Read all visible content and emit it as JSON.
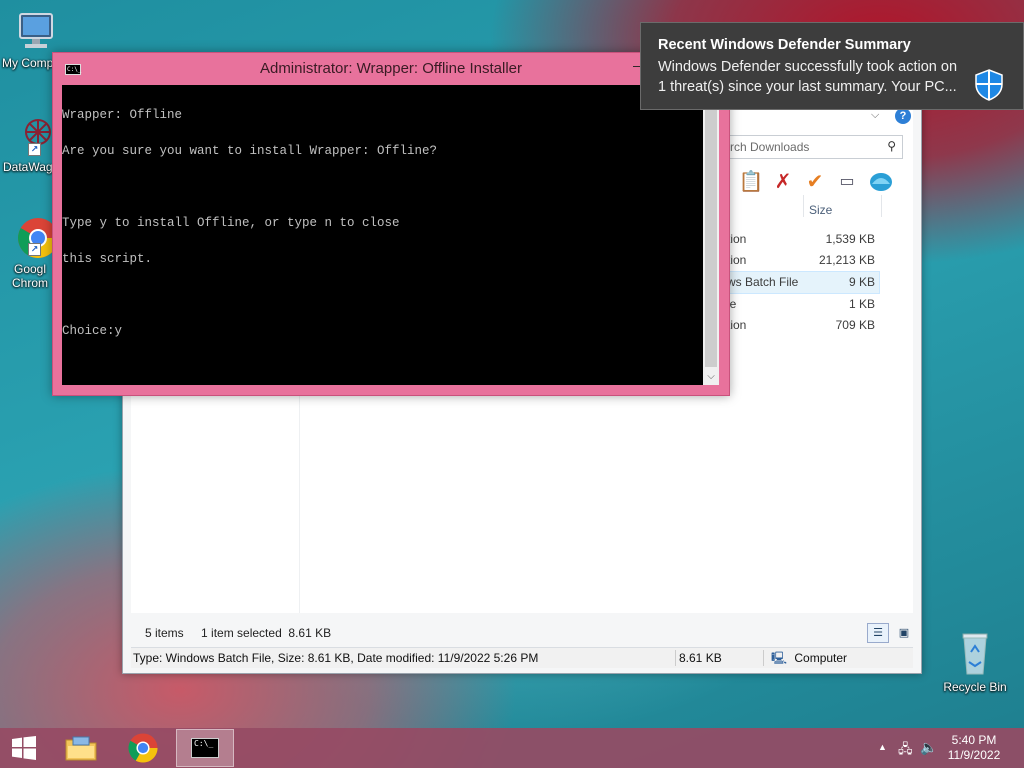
{
  "desktop": {
    "icons": [
      {
        "label": "My Comp"
      },
      {
        "label": "DataWag"
      },
      {
        "label": "Googl Chrom"
      },
      {
        "label": "Recycle Bin"
      }
    ]
  },
  "explorer": {
    "search_placeholder": "rch Downloads",
    "column_size": "Size",
    "rows": [
      {
        "type": "tion",
        "size": "1,539 KB"
      },
      {
        "type": "tion",
        "size": "21,213 KB"
      },
      {
        "type": "ws Batch File",
        "size": "9 KB"
      },
      {
        "type": "le",
        "size": "1 KB"
      },
      {
        "type": "tion",
        "size": "709 KB"
      }
    ],
    "status": {
      "items": "5 items",
      "selected": "1 item selected  8.61 KB",
      "details": "Type: Windows Batch File, Size: 8.61 KB, Date modified: 11/9/2022 5:26 PM",
      "size": "8.61 KB",
      "location": "Computer"
    }
  },
  "console": {
    "title": "Administrator:  Wrapper: Offline Installer",
    "icon_text": "C:\\_",
    "lines": [
      "Wrapper: Offline",
      "Are you sure you want to install Wrapper: Offline?",
      "",
      "Type y to install Offline, or type n to close",
      "this script.",
      "",
      "Choice:y"
    ]
  },
  "toast": {
    "heading": "Recent Windows Defender Summary",
    "body": "Windows Defender successfully took action on 1 threat(s) since your last summary. Your PC..."
  },
  "taskbar": {
    "time": "5:40 PM",
    "date": "11/9/2022"
  },
  "colors": {
    "console_frame": "#e8729c",
    "taskbar": "#964b64",
    "toast_bg": "#3d3d3d"
  }
}
